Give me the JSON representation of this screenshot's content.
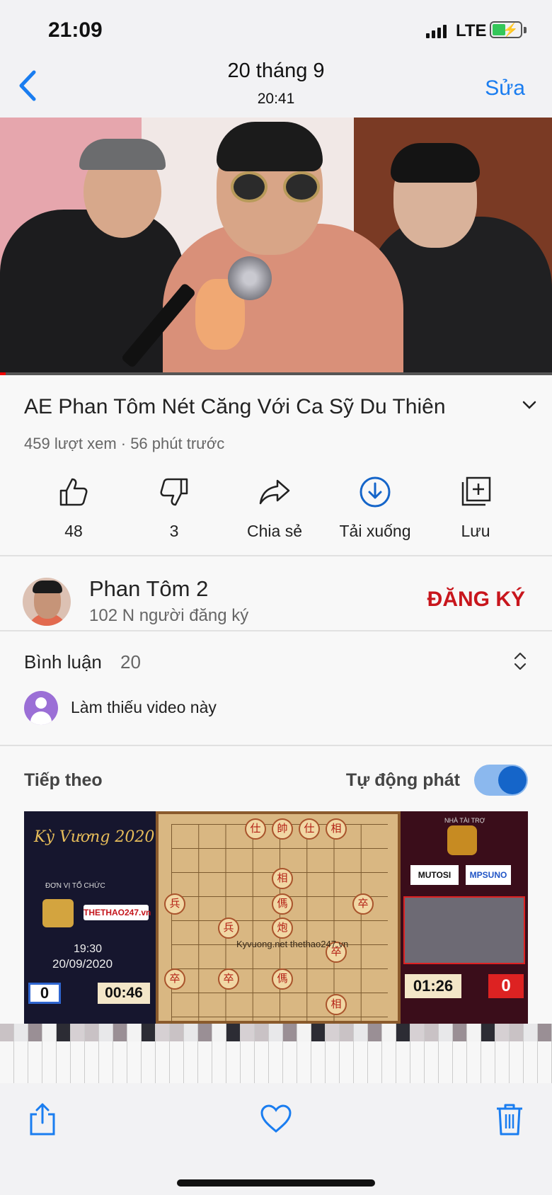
{
  "status_bar": {
    "time": "21:09",
    "network": "LTE"
  },
  "nav": {
    "back_label": "",
    "title": "20 tháng 9",
    "subtitle": "20:41",
    "edit_label": "Sửa"
  },
  "video": {
    "title": "AE Phan Tôm Nét Căng  Với Ca Sỹ Du Thiên",
    "meta": "459 lượt xem · 56 phút trước",
    "actions": [
      {
        "icon": "thumbs-up-icon",
        "label": "48"
      },
      {
        "icon": "thumbs-down-icon",
        "label": "3"
      },
      {
        "icon": "share-icon",
        "label": "Chia sẻ"
      },
      {
        "icon": "download-icon",
        "label": "Tải xuống"
      },
      {
        "icon": "save-icon",
        "label": "Lưu"
      }
    ]
  },
  "channel": {
    "name": "Phan Tôm 2",
    "subscribers": "102 N người đăng ký",
    "subscribe_label": "ĐĂNG KÝ"
  },
  "comments": {
    "heading": "Bình luận",
    "count": "20",
    "first_comment": "Làm thiếu video này"
  },
  "up_next": {
    "label": "Tiếp theo",
    "autoplay_label": "Tự động phát",
    "autoplay_on": true
  },
  "next_video_thumb": {
    "brand": "Kỳ Vương 2020",
    "organizer": "ĐƠN VỊ TỔ CHỨC",
    "logo_text": "THETHAO247.vn",
    "time": "19:30",
    "date": "20/09/2020",
    "left_score": "0",
    "left_clock": "00:46",
    "watermark": "Kyvuong.net thethao247.vn",
    "sponsor_label": "NHÀ TÀI TRỢ",
    "sponsor1": "MUTOSI",
    "sponsor2": "MPSUNO",
    "right_clock": "01:26",
    "right_score": "0",
    "pieces": [
      "仕",
      "帥",
      "仕",
      "相",
      "相",
      "兵",
      "傌",
      "兵",
      "炮",
      "卒",
      "卒",
      "卒",
      "傌",
      "卒",
      "相"
    ]
  },
  "colors": {
    "accent": "#1a7df0",
    "subscribe": "#c8161d",
    "toggle": "#1565c9"
  }
}
